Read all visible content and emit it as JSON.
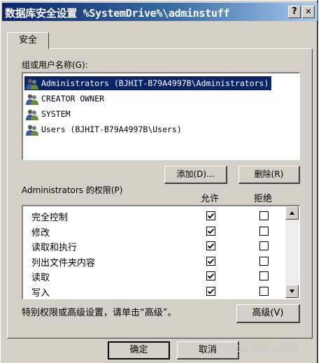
{
  "window": {
    "title": "数据库安全设置 %SystemDrive%\\adminstuff",
    "help_label": "?",
    "close_label": "✕"
  },
  "tabs": [
    {
      "label": "安全"
    }
  ],
  "users_section": {
    "label": "组或用户名称(G):",
    "items": [
      {
        "label": "Administrators (BJHIT-B79A4997B\\Administrators)",
        "selected": true,
        "icon": "user-group-icon"
      },
      {
        "label": "CREATOR OWNER",
        "selected": false,
        "icon": "user-group-icon"
      },
      {
        "label": "SYSTEM",
        "selected": false,
        "icon": "user-group-icon"
      },
      {
        "label": "Users (BJHIT-B79A4997B\\Users)",
        "selected": false,
        "icon": "user-group-icon"
      }
    ],
    "add_button": "添加(D)...",
    "remove_button": "删除(R)"
  },
  "permissions": {
    "label": "Administrators 的权限(P)",
    "allow_header": "允许",
    "deny_header": "拒绝",
    "rows": [
      {
        "name": "完全控制",
        "allow": true,
        "deny": false
      },
      {
        "name": "修改",
        "allow": true,
        "deny": false
      },
      {
        "name": "读取和执行",
        "allow": true,
        "deny": false
      },
      {
        "name": "列出文件夹内容",
        "allow": true,
        "deny": false
      },
      {
        "name": "读取",
        "allow": true,
        "deny": false
      },
      {
        "name": "写入",
        "allow": true,
        "deny": false
      }
    ]
  },
  "advanced": {
    "text": "特别权限或高级设置，请单击“高级”。",
    "button": "高级(V)"
  },
  "footer": {
    "ok_button": "确定",
    "cancel_button": "取消"
  },
  "watermark": "CSDN @是小AD啊",
  "colors": {
    "title_start": "#0a246a",
    "title_end": "#a6caf0",
    "face": "#d4d0c8",
    "selection": "#0a246a"
  }
}
